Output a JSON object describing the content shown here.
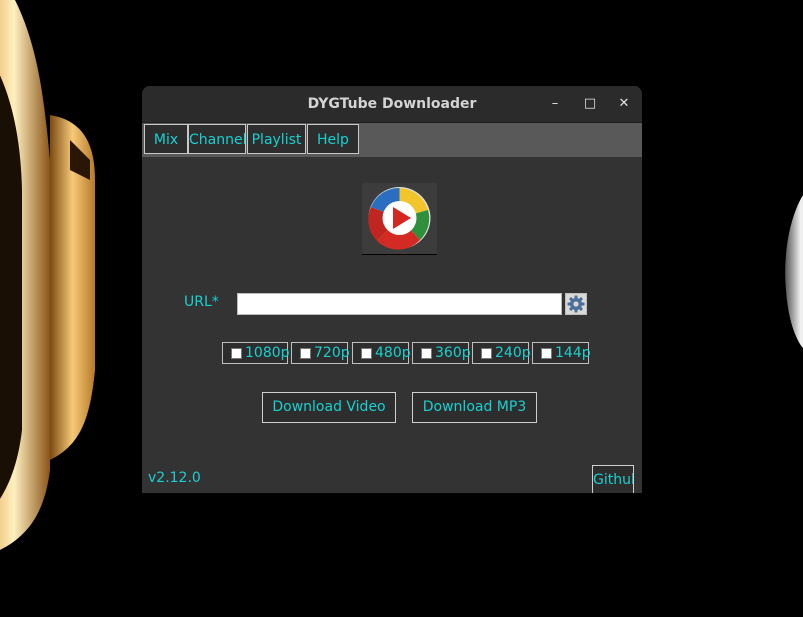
{
  "window": {
    "title": "DYGTube Downloader",
    "controls": {
      "minimize": "–",
      "maximize": "□",
      "close": "✕"
    }
  },
  "menu": {
    "items": [
      {
        "label": "Mix"
      },
      {
        "label": "Channel"
      },
      {
        "label": "Playlist"
      },
      {
        "label": "Help"
      }
    ]
  },
  "form": {
    "url_label": "URL*",
    "url_value": "",
    "url_placeholder": "",
    "settings_icon": "gear-icon"
  },
  "resolutions": [
    {
      "label": "1080p",
      "checked": false
    },
    {
      "label": "720p",
      "checked": false
    },
    {
      "label": "480p",
      "checked": false
    },
    {
      "label": "360p",
      "checked": false
    },
    {
      "label": "240p",
      "checked": false
    },
    {
      "label": "144p",
      "checked": false
    }
  ],
  "actions": {
    "download_video": "Download Video",
    "download_mp3": "Download MP3"
  },
  "footer": {
    "version": "v2.12.0",
    "github": "Github"
  },
  "colors": {
    "accent_text": "#19d0d0",
    "window_bg": "#333333",
    "menubar_bg": "#595959",
    "titlebar_bg": "#2b2b2b"
  }
}
